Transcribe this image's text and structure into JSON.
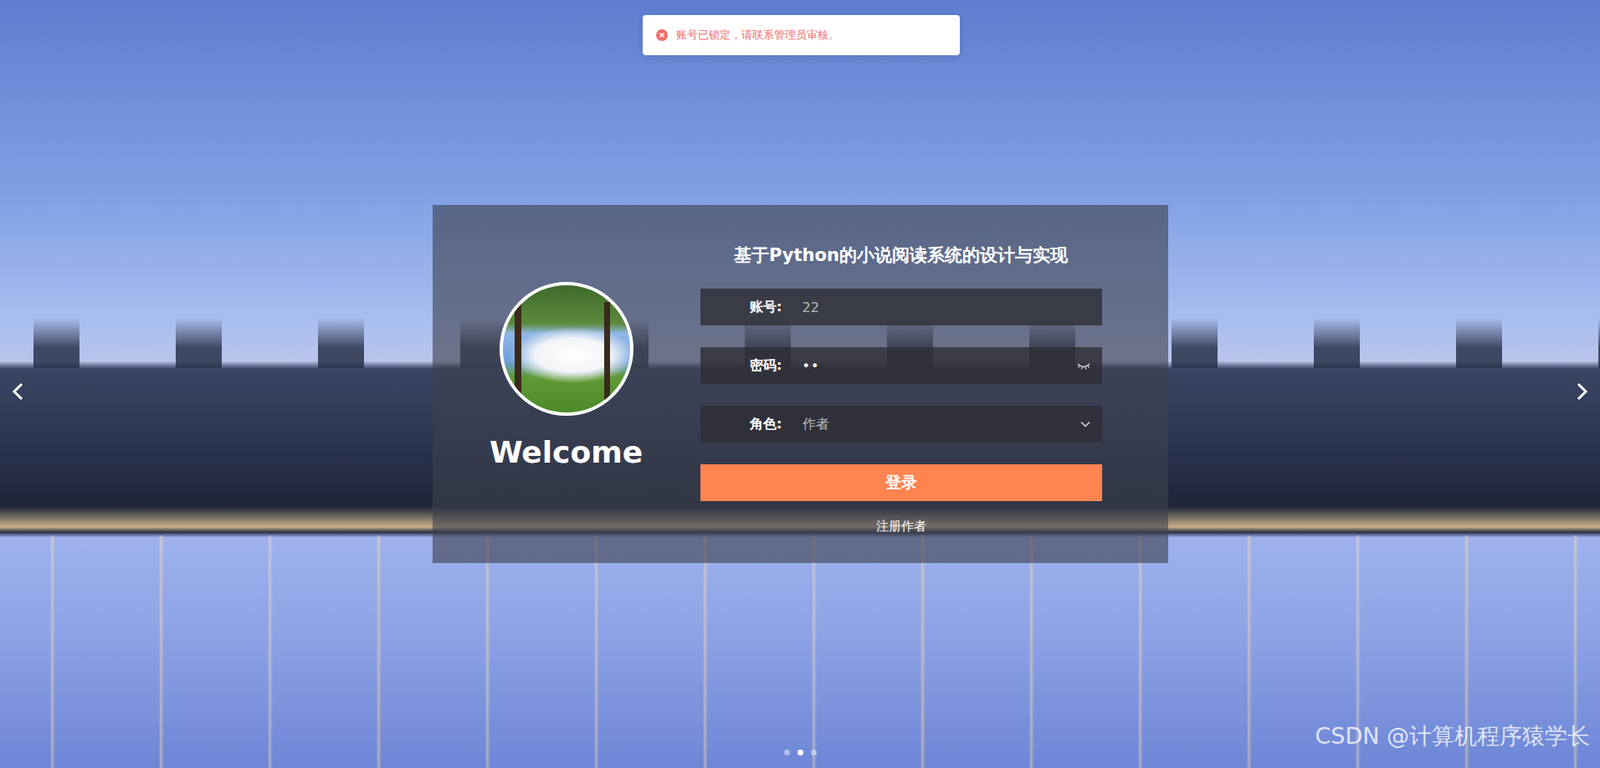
{
  "toast": {
    "message": "账号已锁定，请联系管理员审核。"
  },
  "carousel": {
    "dots": [
      {
        "selected": false
      },
      {
        "selected": true
      },
      {
        "selected": false
      }
    ]
  },
  "login": {
    "title": "基于Python的小说阅读系统的设计与实现",
    "welcome": "Welcome",
    "fields": [
      {
        "label": "账号:",
        "value": "22",
        "kind": "text"
      },
      {
        "label": "密码:",
        "value": "••",
        "kind": "password"
      },
      {
        "label": "角色:",
        "value": "作者",
        "kind": "select"
      }
    ],
    "submit": "登录",
    "register": "注册作者"
  },
  "watermark": "CSDN @计算机程序猿学长"
}
